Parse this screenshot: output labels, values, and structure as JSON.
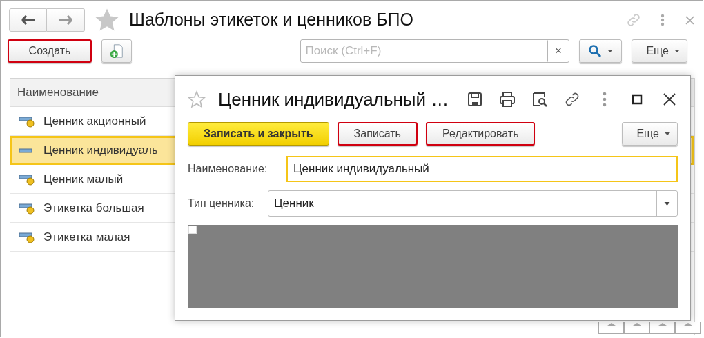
{
  "window": {
    "title": "Шаблоны этикеток и ценников БПО"
  },
  "toolbar": {
    "buttons": [
      {
        "label": "Создать",
        "highlighted": true
      }
    ],
    "search": {
      "placeholder": "Поиск (Ctrl+F)",
      "clear": "×"
    },
    "more": "Еще"
  },
  "list": {
    "columns": [
      "Наименование"
    ],
    "rows": [
      {
        "name": "Ценник акционный",
        "selected": false,
        "dot": true
      },
      {
        "name": "Ценник индивидуаль",
        "selected": true,
        "dot": false
      },
      {
        "name": "Ценник малый",
        "selected": false,
        "dot": true
      },
      {
        "name": "Этикетка большая",
        "selected": false,
        "dot": true
      },
      {
        "name": "Этикетка малая",
        "selected": false,
        "dot": true
      }
    ]
  },
  "dialog": {
    "title": "Ценник индивидуальный …",
    "buttons": [
      {
        "label": "Записать и закрыть",
        "kind": "primary",
        "highlighted": false
      },
      {
        "label": "Записать",
        "kind": "normal",
        "highlighted": true
      },
      {
        "label": "Редактировать",
        "kind": "normal",
        "highlighted": true
      }
    ],
    "more": "Еще",
    "fields": [
      {
        "label": "Наименование:",
        "value": "Ценник индивидуальный",
        "kind": "text",
        "focused": true
      },
      {
        "label": "Тип ценника:",
        "value": "Ценник",
        "kind": "select",
        "focused": false
      }
    ]
  }
}
